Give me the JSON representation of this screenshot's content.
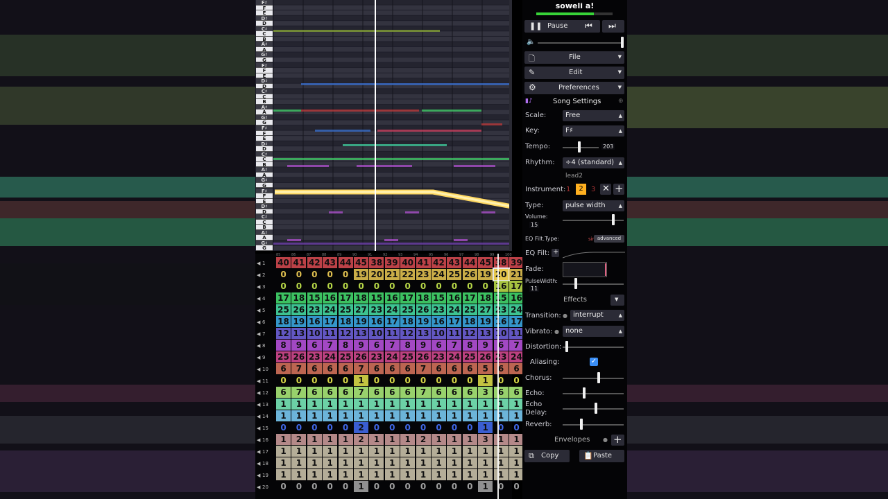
{
  "song": {
    "title": "soweli a!",
    "progress": 0.75
  },
  "transport": {
    "pause_label": "Pause"
  },
  "menus": {
    "file": "File",
    "edit": "Edit",
    "preferences": "Preferences"
  },
  "song_settings": {
    "header": "Song Settings",
    "scale_label": "Scale:",
    "scale_value": "Free",
    "key_label": "Key:",
    "key_value": "F♯",
    "tempo_label": "Tempo:",
    "tempo_value": "203",
    "rhythm_label": "Rhythm:",
    "rhythm_value": "÷4 (standard)"
  },
  "instrument": {
    "name": "lead2",
    "label": "Instrument:",
    "slots": [
      "1",
      "2",
      "3"
    ],
    "selected": "2",
    "type_label": "Type:",
    "type_value": "pulse width",
    "volume_label": "Volume:",
    "volume_value": "15",
    "eq_type_label": "EQ Filt.Type:",
    "eq_simple": "simple",
    "eq_advanced": "advanced",
    "eq_filt_label": "EQ Filt:",
    "fade_label": "Fade:",
    "pulse_label": "PulseWidth:",
    "pulse_value": "11",
    "effects_label": "Effects",
    "transition_label": "Transition:",
    "transition_value": "interrupt",
    "vibrato_label": "Vibrato:",
    "vibrato_value": "none",
    "distortion_label": "Distortion:",
    "aliasing_label": "Aliasing:",
    "chorus_label": "Chorus:",
    "echo_label": "Echo:",
    "echo_delay_label": "Echo Delay:",
    "reverb_label": "Reverb:",
    "envelopes_label": "Envelopes",
    "copy_label": "Copy",
    "paste_label": "Paste"
  },
  "levels": {
    "master_volume": 1.0,
    "tempo": 0.45,
    "volume": 0.85,
    "pulse_width": 0.2,
    "distortion": 0.05,
    "chorus": 0.6,
    "echo": 0.35,
    "echo_delay": 0.55,
    "reverb": 0.3
  },
  "piano_keys": [
    "F♯",
    "F",
    "E",
    "D♯",
    "D",
    "C♯",
    "C",
    "B",
    "A♯",
    "A",
    "G♯",
    "G",
    "F♯",
    "F",
    "E",
    "D♯",
    "D",
    "C♯",
    "C",
    "B",
    "A♯",
    "A",
    "G♯",
    "G",
    "F♯",
    "F",
    "E",
    "D♯",
    "D",
    "C♯",
    "C",
    "B",
    "A♯",
    "A",
    "G♯",
    "G",
    "F♯",
    "F",
    "E",
    "D♯",
    "D",
    "C♯",
    "C",
    "B",
    "A♯",
    "A",
    "G♯",
    "G"
  ],
  "bar_numbers": [
    "85",
    "86",
    "87",
    "88",
    "89",
    "90",
    "91",
    "92",
    "93",
    "94",
    "95",
    "96",
    "97",
    "98",
    "99",
    "100"
  ],
  "channels": [
    {
      "ch": "1",
      "kind": "pitch1",
      "cells": [
        "40",
        "41",
        "42",
        "43",
        "44",
        "45",
        "38",
        "39",
        "40",
        "41",
        "42",
        "43",
        "44",
        "45",
        "38",
        "39"
      ]
    },
    {
      "ch": "2",
      "kind": "pitch2",
      "cells": [
        "0",
        "0",
        "0",
        "0",
        "0",
        "19",
        "20",
        "21",
        "22",
        "23",
        "24",
        "25",
        "26",
        "19",
        "20",
        "21"
      ]
    },
    {
      "ch": "3",
      "kind": "pitch3",
      "cells": [
        "0",
        "0",
        "0",
        "0",
        "0",
        "0",
        "0",
        "0",
        "0",
        "0",
        "0",
        "0",
        "0",
        "0",
        "16",
        "17"
      ]
    },
    {
      "ch": "4",
      "kind": "pitch4",
      "cells": [
        "17",
        "18",
        "15",
        "16",
        "17",
        "18",
        "15",
        "16",
        "17",
        "18",
        "15",
        "16",
        "17",
        "18",
        "15",
        "16"
      ]
    },
    {
      "ch": "5",
      "kind": "pitch5",
      "cells": [
        "25",
        "26",
        "23",
        "24",
        "25",
        "27",
        "23",
        "24",
        "25",
        "26",
        "23",
        "24",
        "25",
        "27",
        "23",
        "24"
      ]
    },
    {
      "ch": "6",
      "kind": "pitch6",
      "cells": [
        "18",
        "19",
        "16",
        "17",
        "18",
        "19",
        "16",
        "17",
        "18",
        "19",
        "16",
        "17",
        "18",
        "19",
        "16",
        "17"
      ]
    },
    {
      "ch": "7",
      "kind": "pitch7",
      "cells": [
        "12",
        "13",
        "10",
        "11",
        "12",
        "13",
        "10",
        "11",
        "12",
        "13",
        "10",
        "11",
        "12",
        "13",
        "10",
        "11"
      ]
    },
    {
      "ch": "8",
      "kind": "pitch8",
      "cells": [
        "8",
        "9",
        "6",
        "7",
        "8",
        "9",
        "6",
        "7",
        "8",
        "9",
        "6",
        "7",
        "8",
        "9",
        "6",
        "7"
      ]
    },
    {
      "ch": "9",
      "kind": "pitch9",
      "cells": [
        "25",
        "26",
        "23",
        "24",
        "25",
        "26",
        "23",
        "24",
        "25",
        "26",
        "23",
        "24",
        "25",
        "26",
        "23",
        "24"
      ]
    },
    {
      "ch": "10",
      "kind": "pitch10",
      "cells": [
        "6",
        "7",
        "6",
        "6",
        "6",
        "7",
        "6",
        "6",
        "6",
        "7",
        "6",
        "6",
        "6",
        "5",
        "6",
        "6"
      ]
    },
    {
      "ch": "11",
      "kind": "noise1",
      "cells": [
        "0",
        "0",
        "0",
        "0",
        "0",
        "1",
        "0",
        "0",
        "0",
        "0",
        "0",
        "0",
        "0",
        "1",
        "0",
        "0"
      ]
    },
    {
      "ch": "12",
      "kind": "noise2",
      "cells": [
        "6",
        "7",
        "6",
        "6",
        "6",
        "7",
        "6",
        "6",
        "6",
        "7",
        "6",
        "6",
        "6",
        "3",
        "6",
        "6"
      ]
    },
    {
      "ch": "13",
      "kind": "noise3",
      "cells": [
        "1",
        "1",
        "1",
        "1",
        "1",
        "1",
        "1",
        "1",
        "1",
        "1",
        "1",
        "1",
        "1",
        "1",
        "1",
        "1"
      ]
    },
    {
      "ch": "14",
      "kind": "noise4",
      "cells": [
        "1",
        "1",
        "1",
        "1",
        "1",
        "1",
        "1",
        "1",
        "1",
        "1",
        "1",
        "1",
        "1",
        "1",
        "1",
        "1"
      ]
    },
    {
      "ch": "15",
      "kind": "noise5",
      "cells": [
        "0",
        "0",
        "0",
        "0",
        "0",
        "2",
        "0",
        "0",
        "0",
        "0",
        "0",
        "0",
        "0",
        "1",
        "0",
        "0"
      ]
    },
    {
      "ch": "16",
      "kind": "mod1",
      "cells": [
        "1",
        "2",
        "1",
        "1",
        "1",
        "2",
        "1",
        "1",
        "1",
        "2",
        "1",
        "1",
        "1",
        "3",
        "1",
        "1"
      ]
    },
    {
      "ch": "17",
      "kind": "mod2",
      "cells": [
        "1",
        "1",
        "1",
        "1",
        "1",
        "1",
        "1",
        "1",
        "1",
        "1",
        "1",
        "1",
        "1",
        "1",
        "1",
        "1"
      ]
    },
    {
      "ch": "18",
      "kind": "mod2",
      "cells": [
        "1",
        "1",
        "1",
        "1",
        "1",
        "1",
        "1",
        "1",
        "1",
        "1",
        "1",
        "1",
        "1",
        "1",
        "1",
        "1"
      ]
    },
    {
      "ch": "19",
      "kind": "mod2",
      "cells": [
        "1",
        "1",
        "1",
        "1",
        "1",
        "1",
        "1",
        "1",
        "1",
        "1",
        "1",
        "1",
        "1",
        "1",
        "1",
        "1"
      ]
    },
    {
      "ch": "20",
      "kind": "mod3",
      "cells": [
        "0",
        "0",
        "0",
        "0",
        "0",
        "1",
        "0",
        "0",
        "0",
        "0",
        "0",
        "0",
        "0",
        "1",
        "0",
        "0"
      ]
    }
  ],
  "colors": {
    "pitch1": "#d0484f",
    "pitch2": "#e0c050",
    "pitch3": "#b8d848",
    "pitch4": "#42d66b",
    "pitch5": "#44d8a0",
    "pitch6": "#3aa6e0",
    "pitch7": "#6e60d8",
    "pitch8": "#b450d8",
    "pitch9": "#d0488e",
    "pitch10": "#d0705a",
    "noise1": "#d8d848",
    "noise2": "#a8e878",
    "noise3": "#78e8b8",
    "noise4": "#78c8f0",
    "noise5": "#4068e8",
    "mod1": "#c89898",
    "mod2": "#c8c0a8",
    "mod3": "#a0a0a0",
    "accent": "#ffdd55",
    "playhead": "#ffffff",
    "check": "#3a8ef5"
  }
}
